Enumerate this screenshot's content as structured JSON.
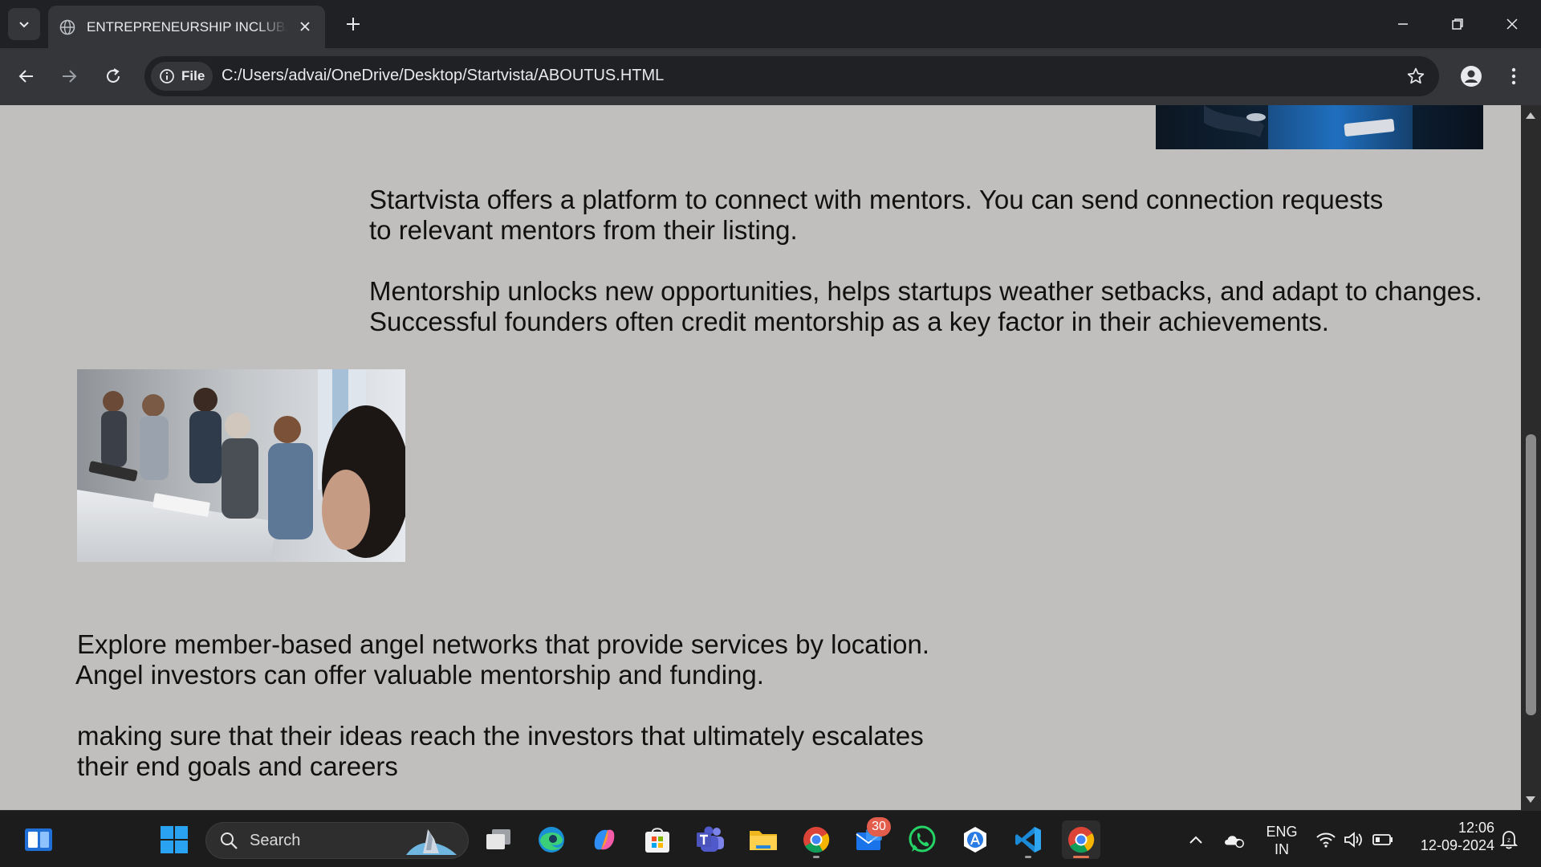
{
  "browser": {
    "tab": {
      "title": "ENTREPRENEURSHIP INCLUBATOR",
      "favicon": "globe-icon"
    },
    "address": {
      "scheme_chip": "File",
      "url": "C:/Users/advai/OneDrive/Desktop/Startvista/ABOUTUS.HTML"
    }
  },
  "page": {
    "mentor_paragraph": {
      "line1": "Startvista offers a platform to connect with mentors. You can send connection requests",
      "line2": "to relevant mentors from their listing."
    },
    "mentorship_paragraph": {
      "line1": "Mentorship unlocks new opportunities, helps startups weather setbacks, and adapt to changes.",
      "line2": "Successful founders often credit mentorship as a key factor in their achievements."
    },
    "angel_paragraph": {
      "line1": "Explore member-based angel networks that provide services by location.",
      "line2": "Angel investors can offer valuable mentorship and funding."
    },
    "investors_paragraph": {
      "line1": "making sure that their ideas reach the investors that ultimately escalates",
      "line2": "their end goals and careers"
    },
    "scroll_position": 0.52
  },
  "taskbar": {
    "search_label": "Search",
    "mail_badge": "30",
    "apps": [
      "widgets-icon",
      "start-icon",
      "task-view-icon",
      "edge-icon",
      "copilot-icon",
      "store-icon",
      "teams-icon",
      "file-explorer-icon",
      "chrome-icon",
      "mail-icon",
      "whatsapp-icon",
      "app-icon",
      "vscode-icon",
      "chrome-active-icon"
    ],
    "tray": {
      "language_line1": "ENG",
      "language_line2": "IN",
      "time": "12:06",
      "date": "12-09-2024"
    }
  },
  "colors": {
    "page_background": "#c0bfbd",
    "titlebar": "#202124",
    "toolbar": "#35363a",
    "taskbar": "#1c1c1c",
    "active_indicator": "#e27352"
  }
}
